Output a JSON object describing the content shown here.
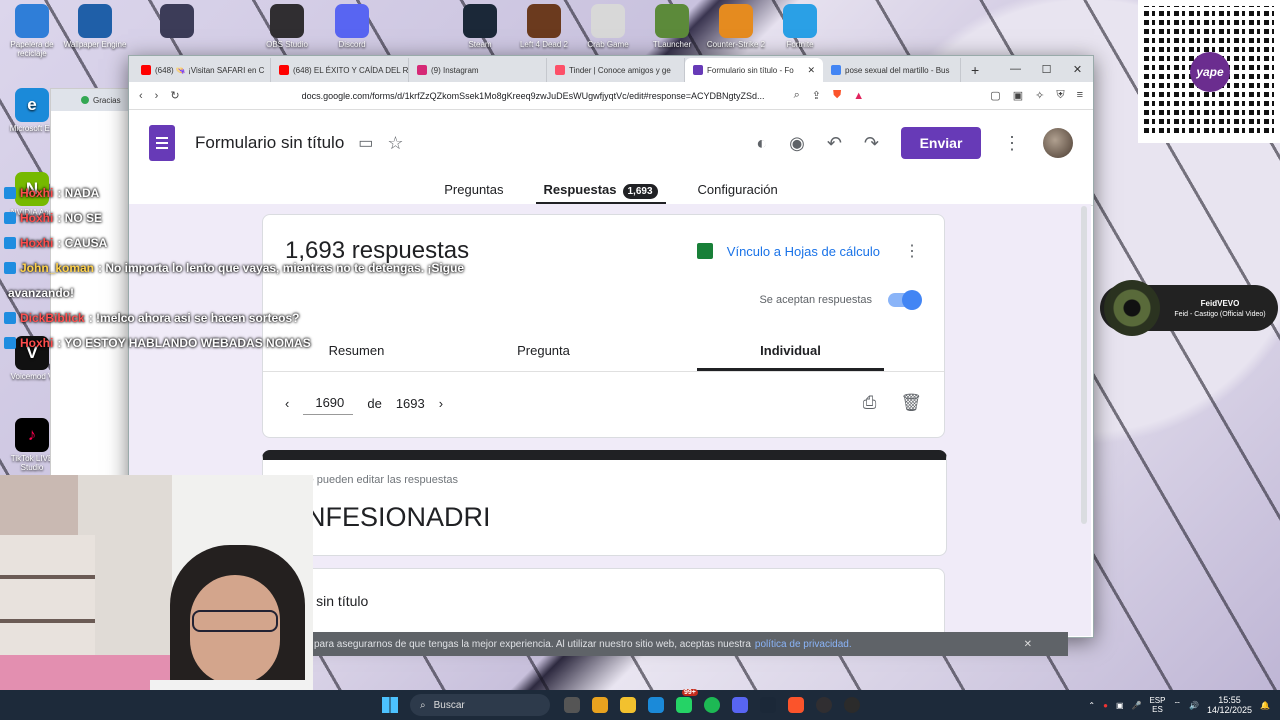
{
  "desktop": {
    "icons": [
      {
        "label": "Papelera de reciclaje",
        "color": "#2f7ed8"
      },
      {
        "label": "Wallpaper Engine",
        "color": "#1f5fa8"
      },
      {
        "label": "",
        "color": "#3c3c58"
      },
      {
        "label": "OBS Studio",
        "color": "#302e31"
      },
      {
        "label": "Discord",
        "color": "#5865f2"
      },
      {
        "label": "Steam",
        "color": "#1b2838"
      },
      {
        "label": "Left 4 Dead 2",
        "color": "#6b3a1e"
      },
      {
        "label": "Crab Game",
        "color": "#d8d8d8"
      },
      {
        "label": "TLauncher",
        "color": "#5c8a3a"
      },
      {
        "label": "Counter-Strike 2",
        "color": "#e58b1f"
      },
      {
        "label": "Fortnite",
        "color": "#2aa0e6"
      }
    ],
    "side_icons": [
      "Microsoft Ed",
      "NVIDIA App",
      "Voicemod V",
      "TikTok LIVE Studio"
    ]
  },
  "qr": {
    "brand": "yape"
  },
  "music": {
    "artist": "FeidVEVO",
    "track": "Feid - Castigo (Official Video)"
  },
  "back_window": {
    "tab": "Gracias"
  },
  "browser": {
    "tabs": [
      {
        "label": "(648) 👒 ¡Visitan SAFARI en C",
        "color": "#ff0000"
      },
      {
        "label": "(648) EL ÉXITO Y CAÍDA DEL R",
        "color": "#ff0000"
      },
      {
        "label": "(9) Instagram",
        "color": "#d62976"
      },
      {
        "label": "Tinder | Conoce amigos y ge",
        "color": "#fd5068"
      },
      {
        "label": "Formulario sin título - Fo",
        "color": "#673ab7",
        "active": true
      },
      {
        "label": "pose sexual del martillo - Bus",
        "color": "#4285f4"
      }
    ],
    "new_tab": "+",
    "url": "docs.google.com/forms/d/1krfZzQZkomSsek1Mo8gKreeq9zwJuDEsWUgwfjyqtVc/edit#response=ACYDBNgtyZSd..."
  },
  "form": {
    "title": "Formulario sin título",
    "send_label": "Enviar",
    "tabs": {
      "questions": "Preguntas",
      "responses": "Respuestas",
      "responses_count": "1,693",
      "settings": "Configuración"
    },
    "summary": {
      "count_text": "1,693 respuestas",
      "sheets_link": "Vínculo a Hojas de cálculo",
      "accepting_label": "Se aceptan respuestas"
    },
    "sub_tabs": {
      "summary": "Resumen",
      "question": "Pregunta",
      "individual": "Individual"
    },
    "pager": {
      "current": "1690",
      "of": "de",
      "total": "1693"
    },
    "response_card": {
      "note": "No se pueden editar las respuestas",
      "title": "ONFESIONADRI"
    },
    "question_card": {
      "title": "unta sin título",
      "answer": "..."
    }
  },
  "cookie_bar": {
    "text": "para asegurarnos de que tengas la mejor experiencia. Al utilizar nuestro sitio web, aceptas nuestra",
    "link": "política de privacidad."
  },
  "chat": [
    {
      "user": "Hoxhi",
      "msg": ": NADA"
    },
    {
      "user": "Hoxhi",
      "msg": ": NO SE"
    },
    {
      "user": "Hoxhi",
      "msg": ": CAUSA"
    },
    {
      "user": "John_koman",
      "msg": ": No importa lo lento que vayas, mientras no te detengas. ¡Sigue"
    },
    {
      "user": "",
      "msg": "avanzando!"
    },
    {
      "user": "DickBiblick",
      "msg": ": !melco ahora asi se hacen sorteos?"
    },
    {
      "user": "Hoxhi",
      "msg": ": YO ESTOY HABLANDO WEBADAS NOMAS"
    }
  ],
  "taskbar": {
    "search_placeholder": "Buscar",
    "lang": "ESP",
    "lang2": "ES",
    "time": "15:55",
    "date": "14/12/2025",
    "badge": "99+"
  }
}
